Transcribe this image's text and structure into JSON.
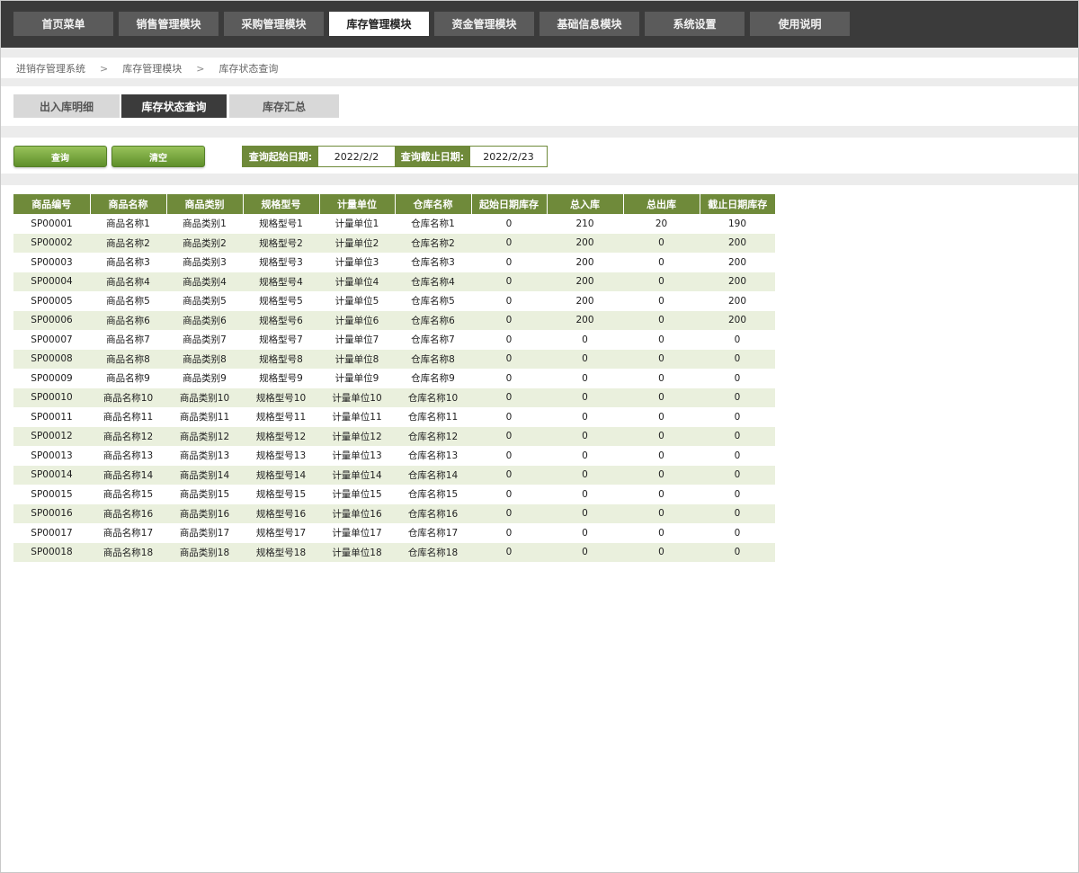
{
  "nav": {
    "items": [
      {
        "label": "首页菜单",
        "active": false
      },
      {
        "label": "销售管理模块",
        "active": false
      },
      {
        "label": "采购管理模块",
        "active": false
      },
      {
        "label": "库存管理模块",
        "active": true
      },
      {
        "label": "资金管理模块",
        "active": false
      },
      {
        "label": "基础信息模块",
        "active": false
      },
      {
        "label": "系统设置",
        "active": false
      },
      {
        "label": "使用说明",
        "active": false
      }
    ]
  },
  "breadcrumb": {
    "items": [
      "进销存管理系统",
      "库存管理模块",
      "库存状态查询"
    ],
    "separator": ">"
  },
  "subtabs": [
    {
      "label": "出入库明细",
      "active": false
    },
    {
      "label": "库存状态查询",
      "active": true
    },
    {
      "label": "库存汇总",
      "active": false
    }
  ],
  "actions": {
    "query_label": "查询",
    "clear_label": "清空"
  },
  "filters": {
    "start_label": "查询起始日期:",
    "start_value": "2022/2/2",
    "end_label": "查询截止日期:",
    "end_value": "2022/2/23"
  },
  "table": {
    "columns": [
      "商品编号",
      "商品名称",
      "商品类别",
      "规格型号",
      "计量单位",
      "仓库名称",
      "起始日期库存",
      "总入库",
      "总出库",
      "截止日期库存"
    ],
    "rows": [
      [
        "SP00001",
        "商品名称1",
        "商品类别1",
        "规格型号1",
        "计量单位1",
        "仓库名称1",
        "0",
        "210",
        "20",
        "190"
      ],
      [
        "SP00002",
        "商品名称2",
        "商品类别2",
        "规格型号2",
        "计量单位2",
        "仓库名称2",
        "0",
        "200",
        "0",
        "200"
      ],
      [
        "SP00003",
        "商品名称3",
        "商品类别3",
        "规格型号3",
        "计量单位3",
        "仓库名称3",
        "0",
        "200",
        "0",
        "200"
      ],
      [
        "SP00004",
        "商品名称4",
        "商品类别4",
        "规格型号4",
        "计量单位4",
        "仓库名称4",
        "0",
        "200",
        "0",
        "200"
      ],
      [
        "SP00005",
        "商品名称5",
        "商品类别5",
        "规格型号5",
        "计量单位5",
        "仓库名称5",
        "0",
        "200",
        "0",
        "200"
      ],
      [
        "SP00006",
        "商品名称6",
        "商品类别6",
        "规格型号6",
        "计量单位6",
        "仓库名称6",
        "0",
        "200",
        "0",
        "200"
      ],
      [
        "SP00007",
        "商品名称7",
        "商品类别7",
        "规格型号7",
        "计量单位7",
        "仓库名称7",
        "0",
        "0",
        "0",
        "0"
      ],
      [
        "SP00008",
        "商品名称8",
        "商品类别8",
        "规格型号8",
        "计量单位8",
        "仓库名称8",
        "0",
        "0",
        "0",
        "0"
      ],
      [
        "SP00009",
        "商品名称9",
        "商品类别9",
        "规格型号9",
        "计量单位9",
        "仓库名称9",
        "0",
        "0",
        "0",
        "0"
      ],
      [
        "SP00010",
        "商品名称10",
        "商品类别10",
        "规格型号10",
        "计量单位10",
        "仓库名称10",
        "0",
        "0",
        "0",
        "0"
      ],
      [
        "SP00011",
        "商品名称11",
        "商品类别11",
        "规格型号11",
        "计量单位11",
        "仓库名称11",
        "0",
        "0",
        "0",
        "0"
      ],
      [
        "SP00012",
        "商品名称12",
        "商品类别12",
        "规格型号12",
        "计量单位12",
        "仓库名称12",
        "0",
        "0",
        "0",
        "0"
      ],
      [
        "SP00013",
        "商品名称13",
        "商品类别13",
        "规格型号13",
        "计量单位13",
        "仓库名称13",
        "0",
        "0",
        "0",
        "0"
      ],
      [
        "SP00014",
        "商品名称14",
        "商品类别14",
        "规格型号14",
        "计量单位14",
        "仓库名称14",
        "0",
        "0",
        "0",
        "0"
      ],
      [
        "SP00015",
        "商品名称15",
        "商品类别15",
        "规格型号15",
        "计量单位15",
        "仓库名称15",
        "0",
        "0",
        "0",
        "0"
      ],
      [
        "SP00016",
        "商品名称16",
        "商品类别16",
        "规格型号16",
        "计量单位16",
        "仓库名称16",
        "0",
        "0",
        "0",
        "0"
      ],
      [
        "SP00017",
        "商品名称17",
        "商品类别17",
        "规格型号17",
        "计量单位17",
        "仓库名称17",
        "0",
        "0",
        "0",
        "0"
      ],
      [
        "SP00018",
        "商品名称18",
        "商品类别18",
        "规格型号18",
        "计量单位18",
        "仓库名称18",
        "0",
        "0",
        "0",
        "0"
      ]
    ]
  },
  "colors": {
    "nav_bg": "#3b3b3b",
    "nav_item": "#5b5b5b",
    "accent_green": "#6f8a3a",
    "row_alt": "#eaf0dd",
    "button_green": "#7aa63f"
  }
}
